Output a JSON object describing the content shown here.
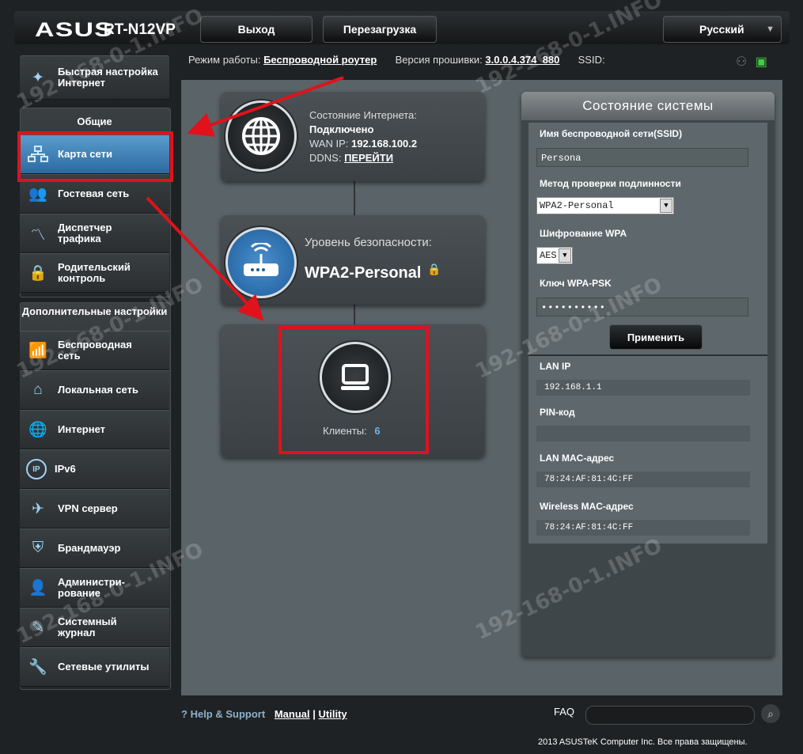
{
  "header": {
    "logo": "ASUS",
    "model": "RT-N12VP",
    "logout_label": "Выход",
    "reboot_label": "Перезагрузка",
    "language": "Русский"
  },
  "modeline": {
    "mode_label": "Режим работы:",
    "mode_value": "Беспроводной роутер",
    "firmware_label": "Версия прошивки:",
    "firmware_value": "3.0.0.4.374_880",
    "ssid_label": "SSID:"
  },
  "sidebar": {
    "quick_setup": "Быстрая настройка Интернет",
    "general_header": "Общие",
    "general_items": [
      {
        "label": "Карта сети"
      },
      {
        "label": "Гостевая сеть"
      },
      {
        "label": "Диспетчер трафика"
      },
      {
        "label": "Родительский контроль"
      }
    ],
    "advanced_header": "Дополнительные настройки",
    "advanced_items": [
      {
        "label": "Беспроводная сеть"
      },
      {
        "label": "Локальная сеть"
      },
      {
        "label": "Интернет"
      },
      {
        "label": "IPv6"
      },
      {
        "label": "VPN сервер"
      },
      {
        "label": "Брандмауэр"
      },
      {
        "label": "Администри-рование"
      },
      {
        "label": "Системный журнал"
      },
      {
        "label": "Сетевые утилиты"
      }
    ]
  },
  "internet_card": {
    "status_label": "Состояние Интернета:",
    "status_value": "Подключено",
    "wan_label": "WAN IP:",
    "wan_value": "192.168.100.2",
    "ddns_label": "DDNS:",
    "ddns_link": "ПЕРЕЙТИ"
  },
  "security_card": {
    "label": "Уровень безопасности:",
    "value": "WPA2-Personal"
  },
  "clients_card": {
    "label": "Клиенты:",
    "count": "6"
  },
  "system_status": {
    "title": "Состояние системы",
    "ssid_label": "Имя беспроводной сети(SSID)",
    "ssid_value": "Persona",
    "auth_label": "Метод проверки подлинности",
    "auth_value": "WPA2-Personal",
    "enc_label": "Шифрование WPA",
    "enc_value": "AES",
    "psk_label": "Ключ WPA-PSK",
    "psk_value": "••••••••••",
    "apply_label": "Применить",
    "lanip_label": "LAN IP",
    "lanip_value": "192.168.1.1",
    "pin_label": "PIN-код",
    "pin_value": "",
    "lanmac_label": "LAN MAC-адрес",
    "lanmac_value": "78:24:AF:81:4C:FF",
    "wmac_label": "Wireless MAC-адрес",
    "wmac_value": "78:24:AF:81:4C:FF"
  },
  "footer": {
    "help": "Help & Support",
    "manual": "Manual",
    "sep": "|",
    "utility": "Utility",
    "faq": "FAQ",
    "copyright": "2013 ASUSTeK Computer Inc. Все права защищены."
  },
  "watermark": "192-168-0-1.INFO",
  "colors": {
    "accent": "#2c6aa0",
    "highlight": "#e0121b",
    "clients_count": "#6fb3e8"
  }
}
